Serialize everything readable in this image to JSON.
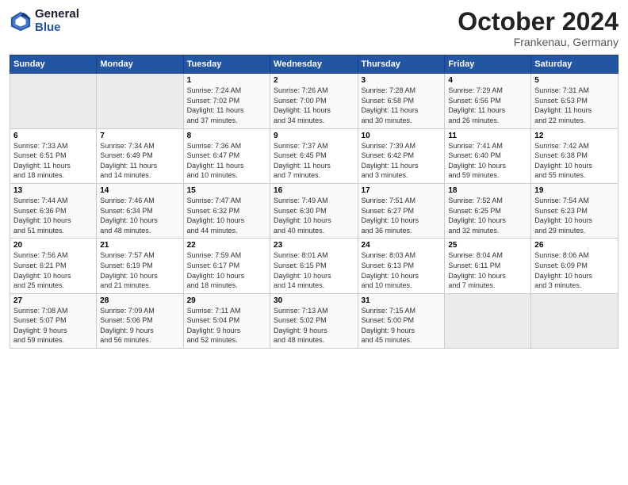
{
  "header": {
    "logo_general": "General",
    "logo_blue": "Blue",
    "month_title": "October 2024",
    "location": "Frankenau, Germany"
  },
  "calendar": {
    "days_of_week": [
      "Sunday",
      "Monday",
      "Tuesday",
      "Wednesday",
      "Thursday",
      "Friday",
      "Saturday"
    ],
    "weeks": [
      {
        "days": [
          {
            "num": "",
            "info": ""
          },
          {
            "num": "",
            "info": ""
          },
          {
            "num": "1",
            "info": "Sunrise: 7:24 AM\nSunset: 7:02 PM\nDaylight: 11 hours\nand 37 minutes."
          },
          {
            "num": "2",
            "info": "Sunrise: 7:26 AM\nSunset: 7:00 PM\nDaylight: 11 hours\nand 34 minutes."
          },
          {
            "num": "3",
            "info": "Sunrise: 7:28 AM\nSunset: 6:58 PM\nDaylight: 11 hours\nand 30 minutes."
          },
          {
            "num": "4",
            "info": "Sunrise: 7:29 AM\nSunset: 6:56 PM\nDaylight: 11 hours\nand 26 minutes."
          },
          {
            "num": "5",
            "info": "Sunrise: 7:31 AM\nSunset: 6:53 PM\nDaylight: 11 hours\nand 22 minutes."
          }
        ]
      },
      {
        "days": [
          {
            "num": "6",
            "info": "Sunrise: 7:33 AM\nSunset: 6:51 PM\nDaylight: 11 hours\nand 18 minutes."
          },
          {
            "num": "7",
            "info": "Sunrise: 7:34 AM\nSunset: 6:49 PM\nDaylight: 11 hours\nand 14 minutes."
          },
          {
            "num": "8",
            "info": "Sunrise: 7:36 AM\nSunset: 6:47 PM\nDaylight: 11 hours\nand 10 minutes."
          },
          {
            "num": "9",
            "info": "Sunrise: 7:37 AM\nSunset: 6:45 PM\nDaylight: 11 hours\nand 7 minutes."
          },
          {
            "num": "10",
            "info": "Sunrise: 7:39 AM\nSunset: 6:42 PM\nDaylight: 11 hours\nand 3 minutes."
          },
          {
            "num": "11",
            "info": "Sunrise: 7:41 AM\nSunset: 6:40 PM\nDaylight: 10 hours\nand 59 minutes."
          },
          {
            "num": "12",
            "info": "Sunrise: 7:42 AM\nSunset: 6:38 PM\nDaylight: 10 hours\nand 55 minutes."
          }
        ]
      },
      {
        "days": [
          {
            "num": "13",
            "info": "Sunrise: 7:44 AM\nSunset: 6:36 PM\nDaylight: 10 hours\nand 51 minutes."
          },
          {
            "num": "14",
            "info": "Sunrise: 7:46 AM\nSunset: 6:34 PM\nDaylight: 10 hours\nand 48 minutes."
          },
          {
            "num": "15",
            "info": "Sunrise: 7:47 AM\nSunset: 6:32 PM\nDaylight: 10 hours\nand 44 minutes."
          },
          {
            "num": "16",
            "info": "Sunrise: 7:49 AM\nSunset: 6:30 PM\nDaylight: 10 hours\nand 40 minutes."
          },
          {
            "num": "17",
            "info": "Sunrise: 7:51 AM\nSunset: 6:27 PM\nDaylight: 10 hours\nand 36 minutes."
          },
          {
            "num": "18",
            "info": "Sunrise: 7:52 AM\nSunset: 6:25 PM\nDaylight: 10 hours\nand 32 minutes."
          },
          {
            "num": "19",
            "info": "Sunrise: 7:54 AM\nSunset: 6:23 PM\nDaylight: 10 hours\nand 29 minutes."
          }
        ]
      },
      {
        "days": [
          {
            "num": "20",
            "info": "Sunrise: 7:56 AM\nSunset: 6:21 PM\nDaylight: 10 hours\nand 25 minutes."
          },
          {
            "num": "21",
            "info": "Sunrise: 7:57 AM\nSunset: 6:19 PM\nDaylight: 10 hours\nand 21 minutes."
          },
          {
            "num": "22",
            "info": "Sunrise: 7:59 AM\nSunset: 6:17 PM\nDaylight: 10 hours\nand 18 minutes."
          },
          {
            "num": "23",
            "info": "Sunrise: 8:01 AM\nSunset: 6:15 PM\nDaylight: 10 hours\nand 14 minutes."
          },
          {
            "num": "24",
            "info": "Sunrise: 8:03 AM\nSunset: 6:13 PM\nDaylight: 10 hours\nand 10 minutes."
          },
          {
            "num": "25",
            "info": "Sunrise: 8:04 AM\nSunset: 6:11 PM\nDaylight: 10 hours\nand 7 minutes."
          },
          {
            "num": "26",
            "info": "Sunrise: 8:06 AM\nSunset: 6:09 PM\nDaylight: 10 hours\nand 3 minutes."
          }
        ]
      },
      {
        "days": [
          {
            "num": "27",
            "info": "Sunrise: 7:08 AM\nSunset: 5:07 PM\nDaylight: 9 hours\nand 59 minutes."
          },
          {
            "num": "28",
            "info": "Sunrise: 7:09 AM\nSunset: 5:06 PM\nDaylight: 9 hours\nand 56 minutes."
          },
          {
            "num": "29",
            "info": "Sunrise: 7:11 AM\nSunset: 5:04 PM\nDaylight: 9 hours\nand 52 minutes."
          },
          {
            "num": "30",
            "info": "Sunrise: 7:13 AM\nSunset: 5:02 PM\nDaylight: 9 hours\nand 48 minutes."
          },
          {
            "num": "31",
            "info": "Sunrise: 7:15 AM\nSunset: 5:00 PM\nDaylight: 9 hours\nand 45 minutes."
          },
          {
            "num": "",
            "info": ""
          },
          {
            "num": "",
            "info": ""
          }
        ]
      }
    ]
  }
}
